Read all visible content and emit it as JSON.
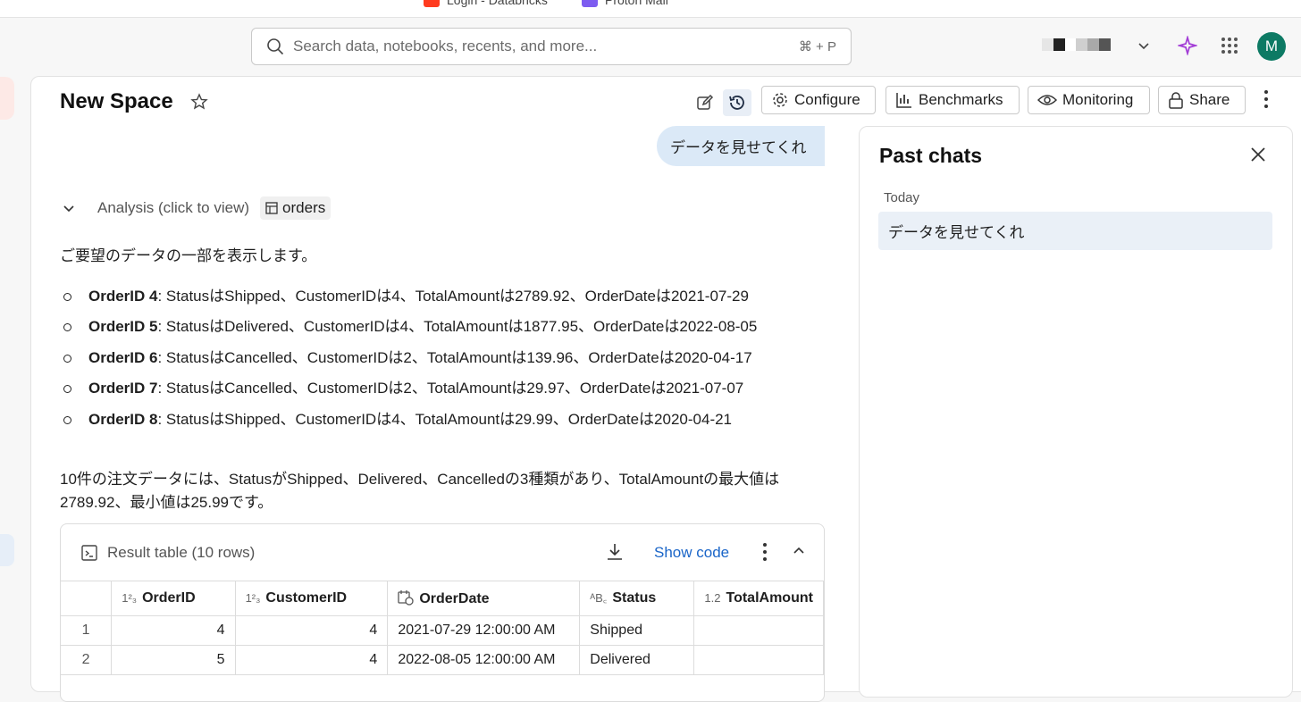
{
  "bookmarks": [
    {
      "label": "Login - Databricks"
    },
    {
      "label": "Proton Mail"
    }
  ],
  "topbar": {
    "search_placeholder": "Search data, notebooks, recents, and more...",
    "search_shortcut": "⌘ + P",
    "avatar_letter": "M"
  },
  "space": {
    "title": "New Space",
    "buttons": {
      "configure": "Configure",
      "benchmarks": "Benchmarks",
      "monitoring": "Monitoring",
      "share": "Share"
    }
  },
  "chat": {
    "user_message": "データを見せてくれ",
    "analysis_label": "Analysis (click to view)",
    "table_tag": "orders",
    "intro": "ご要望のデータの一部を表示します。",
    "bullets": [
      {
        "id": "OrderID 4",
        "text": ": StatusはShipped、CustomerIDは4、TotalAmountは2789.92、OrderDateは2021-07-29"
      },
      {
        "id": "OrderID 5",
        "text": ": StatusはDelivered、CustomerIDは4、TotalAmountは1877.95、OrderDateは2022-08-05"
      },
      {
        "id": "OrderID 6",
        "text": ": StatusはCancelled、CustomerIDは2、TotalAmountは139.96、OrderDateは2020-04-17"
      },
      {
        "id": "OrderID 7",
        "text": ": StatusはCancelled、CustomerIDは2、TotalAmountは29.97、OrderDateは2021-07-07"
      },
      {
        "id": "OrderID 8",
        "text": ": StatusはShipped、CustomerIDは4、TotalAmountは29.99、OrderDateは2020-04-21"
      }
    ],
    "summary": "10件の注文データには、StatusがShipped、Delivered、Cancelledの3種類があり、TotalAmountの最大値は2789.92、最小値は25.99です。"
  },
  "result": {
    "title": "Result table (10 rows)",
    "show_code": "Show code",
    "columns": [
      {
        "type": "1²₃",
        "name": "OrderID"
      },
      {
        "type": "1²₃",
        "name": "CustomerID"
      },
      {
        "type": "",
        "name": "OrderDate"
      },
      {
        "type": "ᴬB꜀",
        "name": "Status"
      },
      {
        "type": "1.2",
        "name": "TotalAmount"
      }
    ],
    "rows": [
      {
        "idx": "1",
        "OrderID": "4",
        "CustomerID": "4",
        "OrderDate": "2021-07-29 12:00:00 AM",
        "Status": "Shipped",
        "TotalAmount": ""
      },
      {
        "idx": "2",
        "OrderID": "5",
        "CustomerID": "4",
        "OrderDate": "2022-08-05 12:00:00 AM",
        "Status": "Delivered",
        "TotalAmount": ""
      }
    ]
  },
  "past_chats": {
    "title": "Past chats",
    "group": "Today",
    "items": [
      "データを見せてくれ"
    ]
  },
  "colors": {
    "accent_link": "#1a65c8",
    "avatar": "#0d7a64",
    "user_bubble": "#dbe9f7",
    "selected_chat": "#eaf0f7"
  }
}
